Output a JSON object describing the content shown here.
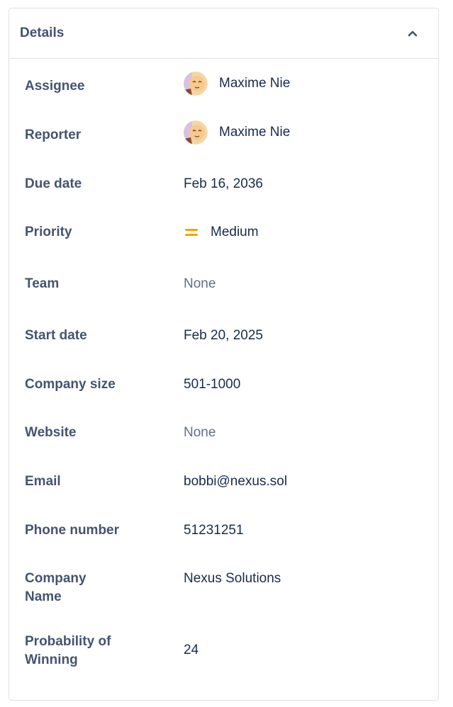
{
  "header": {
    "title": "Details"
  },
  "fields": {
    "assignee": {
      "label": "Assignee",
      "value": "Maxime Nie"
    },
    "reporter": {
      "label": "Reporter",
      "value": "Maxime Nie"
    },
    "due_date": {
      "label": "Due date",
      "value": "Feb 16, 2036"
    },
    "priority": {
      "label": "Priority",
      "value": "Medium",
      "color": "#f5a300"
    },
    "team": {
      "label": "Team",
      "value": "None"
    },
    "start_date": {
      "label": "Start date",
      "value": "Feb 20, 2025"
    },
    "company_size": {
      "label": "Company size",
      "value": "501-1000"
    },
    "website": {
      "label": "Website",
      "value": "None"
    },
    "email": {
      "label": "Email",
      "value": "bobbi@nexus.sol"
    },
    "phone": {
      "label": "Phone number",
      "value": "51231251"
    },
    "company_name": {
      "label_line1": "Company",
      "label_line2": "Name",
      "value": "Nexus Solutions"
    },
    "probability": {
      "label_line1": "Probability of",
      "label_line2": "Winning",
      "value": "24"
    }
  },
  "icons": {
    "collapse": "chevron-up-icon",
    "priority": "priority-medium-icon",
    "avatar": "user-avatar"
  }
}
